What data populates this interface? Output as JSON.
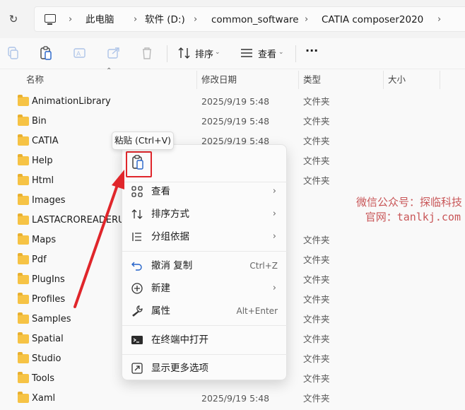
{
  "address_bar": {
    "crumbs": [
      "此电脑",
      "软件 (D:)",
      "common_software",
      "CATIA composer2020"
    ]
  },
  "command_bar": {
    "sort_label": "排序",
    "view_label": "查看",
    "more_label": "···"
  },
  "columns": {
    "name": "名称",
    "date": "修改日期",
    "type": "类型",
    "size": "大小"
  },
  "files": [
    {
      "name": "AnimationLibrary",
      "date": "2025/9/19 5:48",
      "type": "文件夹"
    },
    {
      "name": "Bin",
      "date": "2025/9/19 5:48",
      "type": "文件夹"
    },
    {
      "name": "CATIA",
      "date": "2025/9/19 5:48",
      "type": "文件夹"
    },
    {
      "name": "Help",
      "date": "",
      "type": "文件夹"
    },
    {
      "name": "Html",
      "date": "",
      "type": "文件夹"
    },
    {
      "name": "Images",
      "date": "",
      "type": ""
    },
    {
      "name": "LASTACROREADERUS",
      "date": "",
      "type": ""
    },
    {
      "name": "Maps",
      "date": "",
      "type": "文件夹"
    },
    {
      "name": "Pdf",
      "date": "",
      "type": "文件夹"
    },
    {
      "name": "PlugIns",
      "date": "",
      "type": "文件夹"
    },
    {
      "name": "Profiles",
      "date": "",
      "type": "文件夹"
    },
    {
      "name": "Samples",
      "date": "",
      "type": "文件夹"
    },
    {
      "name": "Spatial",
      "date": "",
      "type": "文件夹"
    },
    {
      "name": "Studio",
      "date": "",
      "type": "文件夹"
    },
    {
      "name": "Tools",
      "date": "",
      "type": "文件夹"
    },
    {
      "name": "Xaml",
      "date": "2025/9/19 5:48",
      "type": "文件夹"
    }
  ],
  "tooltip": "粘贴 (Ctrl+V)",
  "context_menu": {
    "items": [
      {
        "label": "查看",
        "shortcut": "",
        "submenu": true,
        "icon": "grid-icon"
      },
      {
        "label": "排序方式",
        "shortcut": "",
        "submenu": true,
        "icon": "sort-icon"
      },
      {
        "label": "分组依据",
        "shortcut": "",
        "submenu": true,
        "icon": "group-icon"
      },
      {
        "label": "撤消 复制",
        "shortcut": "Ctrl+Z",
        "submenu": false,
        "icon": "undo-icon"
      },
      {
        "label": "新建",
        "shortcut": "",
        "submenu": true,
        "icon": "plus-circle-icon"
      },
      {
        "label": "属性",
        "shortcut": "Alt+Enter",
        "submenu": false,
        "icon": "wrench-icon"
      },
      {
        "label": "在终端中打开",
        "shortcut": "",
        "submenu": false,
        "icon": "terminal-icon"
      },
      {
        "label": "显示更多选项",
        "shortcut": "",
        "submenu": false,
        "icon": "more-options-icon"
      }
    ]
  },
  "watermark": {
    "line1": "微信公众号：探临科技",
    "line2": "官网：tanlkj.com"
  },
  "colors": {
    "highlight_red": "#e0262b",
    "folder_yellow": "#f6c345"
  }
}
